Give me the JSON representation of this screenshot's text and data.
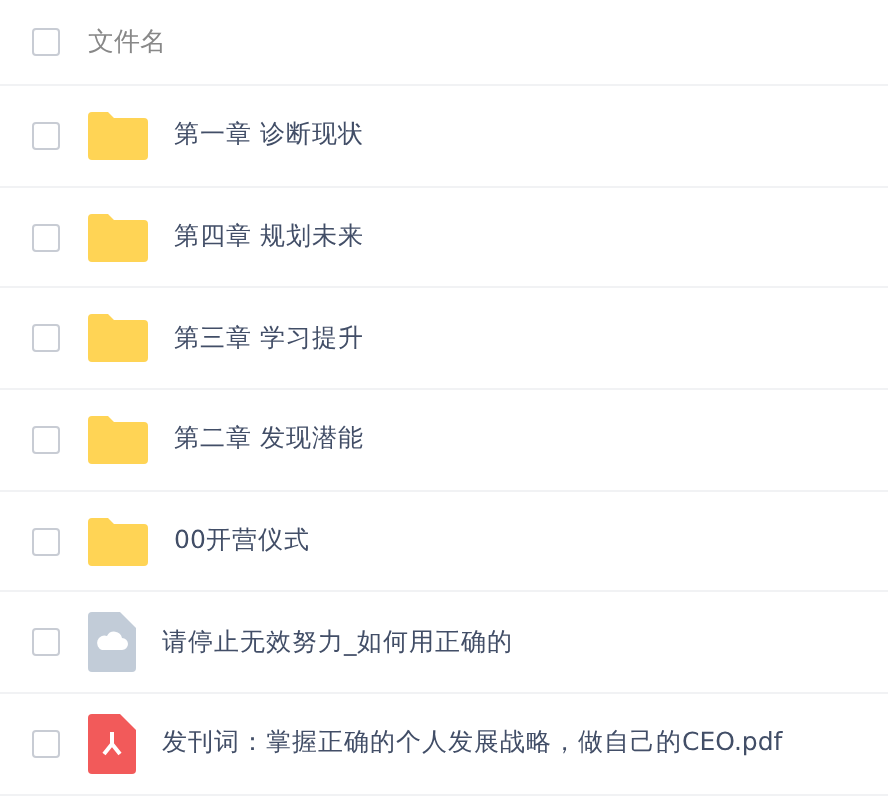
{
  "header": {
    "checked": false,
    "label": "文件名"
  },
  "files": [
    {
      "kind": "folder",
      "name": "第一章 诊断现状",
      "checked": false
    },
    {
      "kind": "folder",
      "name": "第四章 规划未来",
      "checked": false
    },
    {
      "kind": "folder",
      "name": "第三章 学习提升",
      "checked": false
    },
    {
      "kind": "folder",
      "name": "第二章 发现潜能",
      "checked": false
    },
    {
      "kind": "folder",
      "name": "00开营仪式",
      "checked": false
    },
    {
      "kind": "cloud-file",
      "name": "请停止无效努力_如何用正确的",
      "checked": false
    },
    {
      "kind": "pdf",
      "name": "发刊词：掌握正确的个人发展战略，做自己的CEO.pdf",
      "checked": false
    }
  ]
}
